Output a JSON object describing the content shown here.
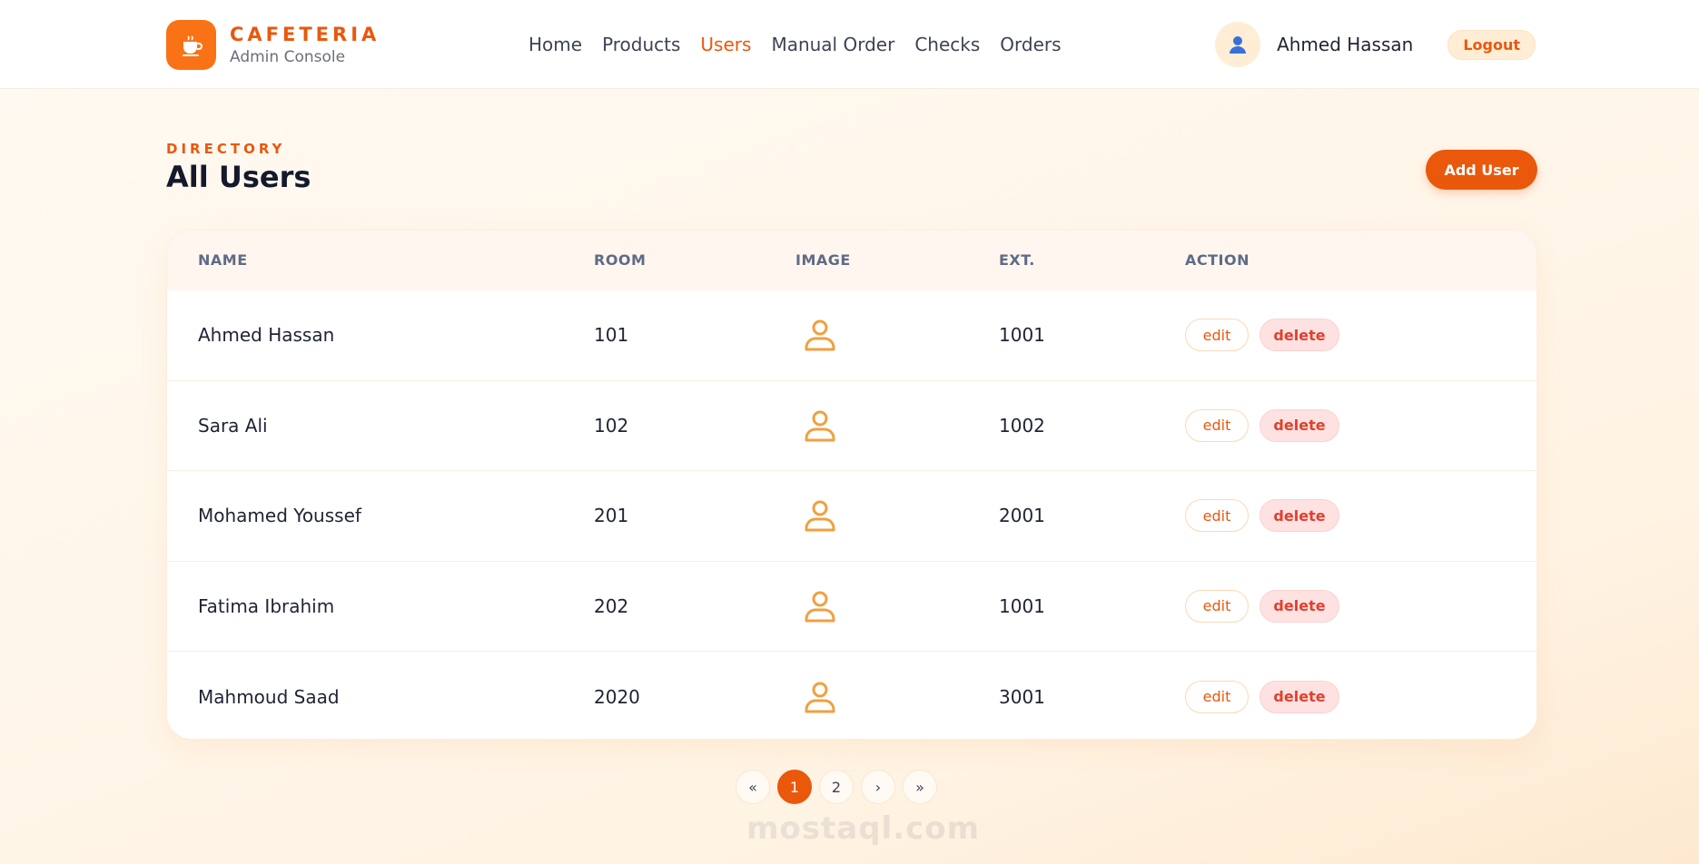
{
  "brand": {
    "name": "CAFETERIA",
    "subtitle": "Admin Console"
  },
  "nav": [
    {
      "label": "Home",
      "active": false
    },
    {
      "label": "Products",
      "active": false
    },
    {
      "label": "Users",
      "active": true
    },
    {
      "label": "Manual Order",
      "active": false
    },
    {
      "label": "Checks",
      "active": false
    },
    {
      "label": "Orders",
      "active": false
    }
  ],
  "user": {
    "name": "Ahmed Hassan",
    "logout_label": "Logout"
  },
  "page": {
    "eyebrow": "DIRECTORY",
    "title": "All Users",
    "add_button": "Add User"
  },
  "table": {
    "headers": {
      "name": "NAME",
      "room": "ROOM",
      "image": "IMAGE",
      "ext": "EXT.",
      "action": "ACTION"
    },
    "rows": [
      {
        "name": "Ahmed Hassan",
        "room": "101",
        "ext": "1001"
      },
      {
        "name": "Sara Ali",
        "room": "102",
        "ext": "1002"
      },
      {
        "name": "Mohamed Youssef",
        "room": "201",
        "ext": "2001"
      },
      {
        "name": "Fatima Ibrahim",
        "room": "202",
        "ext": "1001"
      },
      {
        "name": "Mahmoud Saad",
        "room": "2020",
        "ext": "3001"
      }
    ],
    "edit_label": "edit",
    "delete_label": "delete"
  },
  "pagination": {
    "first": "«",
    "pages": [
      "1",
      "2"
    ],
    "current": "1",
    "next": "›",
    "last": "»"
  },
  "watermark": "mostaql.com",
  "colors": {
    "accent": "#ea580c",
    "avatar_icon": "#f0a040",
    "danger": "#e0402f"
  }
}
